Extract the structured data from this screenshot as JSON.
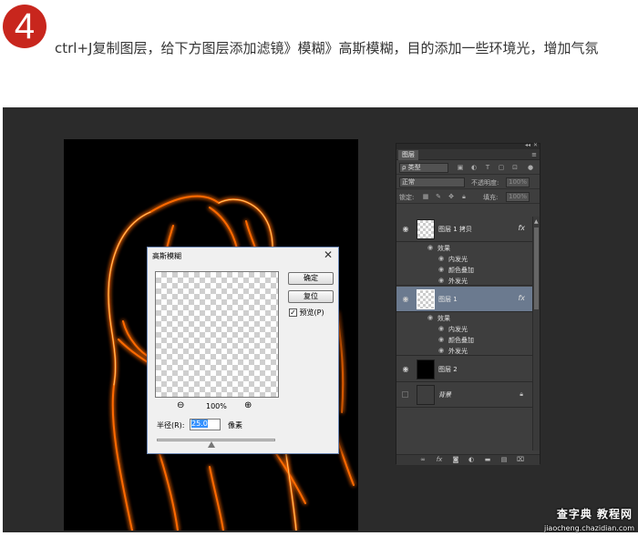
{
  "step": {
    "number": "4",
    "text": "ctrl+J复制图层，给下方图层添加滤镜》模糊》高斯模糊，目的添加一些环境光，增加气氛"
  },
  "dialog": {
    "title": "高斯模糊",
    "close": "✕",
    "ok_label": "确定",
    "reset_label": "复位",
    "preview_label": "预览(P)",
    "preview_checked": true,
    "zoom_out": "⊖",
    "zoom_value": "100%",
    "zoom_in": "⊕",
    "radius_label": "半径(R):",
    "radius_value": "25.0",
    "radius_unit": "像素"
  },
  "layers_panel": {
    "tab": "图层",
    "filter_label": "ρ 类型",
    "blend_mode": "正常",
    "opacity_label": "不透明度:",
    "opacity_value": "100%",
    "lock_label": "锁定:",
    "fill_label": "填充:",
    "fill_value": "100%",
    "layers": [
      {
        "name": "图层 1 拷贝",
        "visible": true,
        "fx": "fx",
        "effects_label": "效果",
        "effects": [
          "内发光",
          "颜色叠加",
          "外发光"
        ]
      },
      {
        "name": "图层 1",
        "visible": true,
        "selected": true,
        "fx": "fx",
        "effects_label": "效果",
        "effects": [
          "内发光",
          "颜色叠加",
          "外发光"
        ]
      },
      {
        "name": "图层 2",
        "visible": true
      },
      {
        "name": "背景",
        "visible": false,
        "locked": true
      }
    ],
    "bottom_icons": [
      "link-icon",
      "fx-icon",
      "mask-icon",
      "adjustment-icon",
      "group-icon",
      "new-layer-icon",
      "trash-icon"
    ]
  },
  "watermark": {
    "main": "查字典 教程网",
    "sub": "jiaocheng.chazidian.com"
  },
  "colors": {
    "badge": "#c8261d",
    "glow_outer": "#ff5a00",
    "glow_inner": "#ffd27a",
    "selection": "#6b7a8f"
  }
}
